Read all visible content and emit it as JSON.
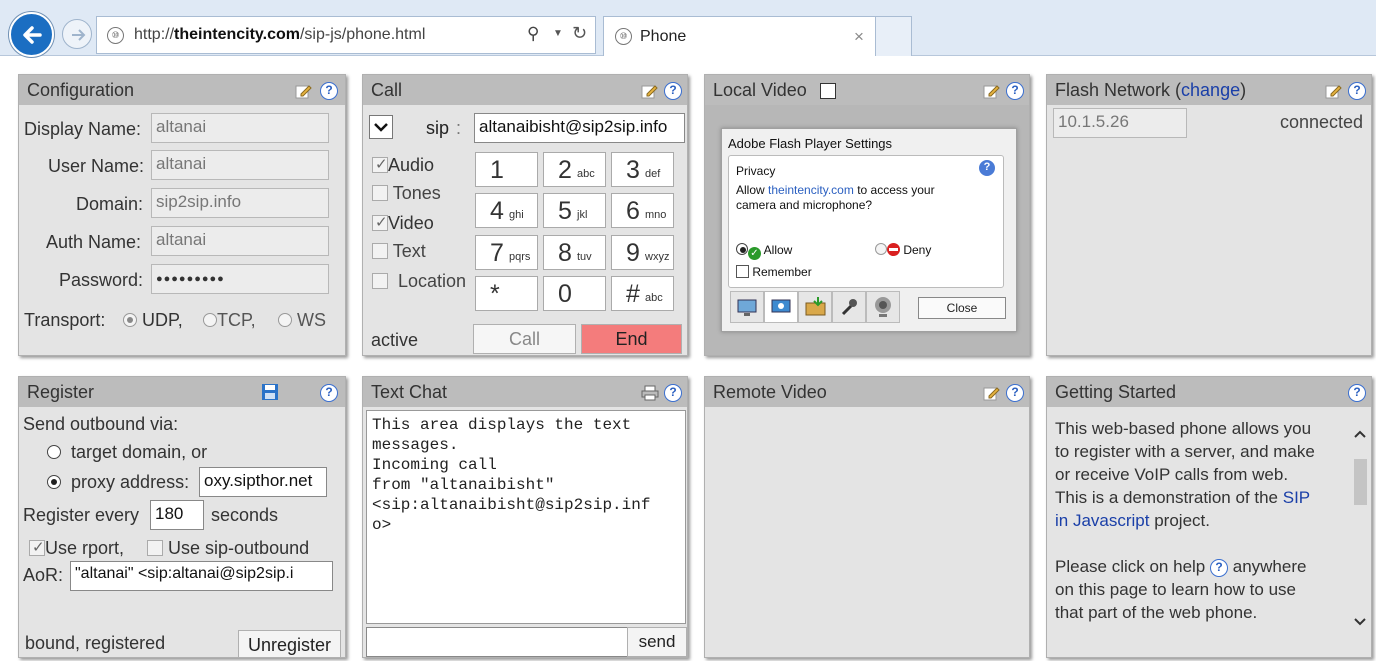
{
  "browser": {
    "url_prefix": "http://",
    "url_domain": "theintencity.com",
    "url_path": "/sip-js/phone.html",
    "tab_title": "Phone"
  },
  "configuration": {
    "title": "Configuration",
    "display_name_label": "Display Name:",
    "display_name": "altanai",
    "user_name_label": "User Name:",
    "user_name": "altanai",
    "domain_label": "Domain:",
    "domain": "sip2sip.info",
    "auth_name_label": "Auth Name:",
    "auth_name": "altanai",
    "password_label": "Password:",
    "password": "●●●●●●●●●",
    "transport_label": "Transport:",
    "transport_options": [
      "UDP,",
      "TCP,",
      "WS"
    ],
    "transport_selected": "UDP"
  },
  "call": {
    "title": "Call",
    "sip_label": "sip",
    "sip_colon": ":",
    "target": "altanaibisht@sip2sip.info",
    "options": [
      "Audio",
      "Tones",
      "Video",
      "Text",
      "Location"
    ],
    "keys": [
      {
        "digit": "1",
        "sub": ""
      },
      {
        "digit": "2",
        "sub": "abc"
      },
      {
        "digit": "3",
        "sub": "def"
      },
      {
        "digit": "4",
        "sub": "ghi"
      },
      {
        "digit": "5",
        "sub": "jkl"
      },
      {
        "digit": "6",
        "sub": "mno"
      },
      {
        "digit": "7",
        "sub": "pqrs"
      },
      {
        "digit": "8",
        "sub": "tuv"
      },
      {
        "digit": "9",
        "sub": "wxyz"
      },
      {
        "digit": "*",
        "sub": ""
      },
      {
        "digit": "0",
        "sub": ""
      },
      {
        "digit": "#",
        "sub": "abc"
      }
    ],
    "status": "active",
    "call_label": "Call",
    "end_label": "End"
  },
  "local_video": {
    "title": "Local Video",
    "flash_dialog_title": "Adobe Flash Player Settings",
    "privacy_label": "Privacy",
    "allow_text_pre": "Allow",
    "allow_text_link": "theintencity.com",
    "allow_text_post": "to access your",
    "allow_text_line2": "camera and microphone?",
    "allow_label": "Allow",
    "deny_label": "Deny",
    "remember_label": "Remember",
    "close_label": "Close"
  },
  "flash_network": {
    "title_pre": "Flash Network (",
    "title_link": "change",
    "title_post": ")",
    "ip": "10.1.5.26",
    "status": "connected"
  },
  "register": {
    "title": "Register",
    "send_outbound_label": "Send outbound via:",
    "target_domain_label": "target domain, or",
    "proxy_address_label": "proxy address:",
    "proxy_address": "oxy.sipthor.net",
    "register_every_label": "Register every",
    "register_every": "180",
    "seconds_label": "seconds",
    "use_rport_label": "Use rport,",
    "use_sip_outbound_label": "Use sip-outbound",
    "aor_label": "AoR:",
    "aor": "\"altanai\" <sip:altanai@sip2sip.i",
    "status": "bound, registered",
    "unregister_label": "Unregister"
  },
  "text_chat": {
    "title": "Text Chat",
    "lines": [
      "This area displays the text",
      "messages.",
      "Incoming call",
      "from \"altanaibisht\"",
      "<sip:altanaibisht@sip2sip.inf",
      "o>"
    ],
    "input": "",
    "send_label": "send"
  },
  "remote_video": {
    "title": "Remote Video"
  },
  "getting_started": {
    "title": "Getting Started",
    "p1_lines": [
      "This web-based phone allows you",
      "to register with a server, and make",
      "or receive VoIP calls from web.",
      "This is a demonstration of the"
    ],
    "p1_link_a": "SIP",
    "p1_link_b": "in Javascript",
    "p1_tail": "project.",
    "p2_pre": "Please click on help",
    "p2_post": "anywhere",
    "p2_lines": [
      "on this page to learn how to use",
      "that part of the web phone."
    ]
  },
  "colors": {
    "panel_bg": "#e4e4e4",
    "panel_header": "#bcbcbc",
    "end_button": "#f47c7c",
    "link": "#1a3fa8"
  }
}
